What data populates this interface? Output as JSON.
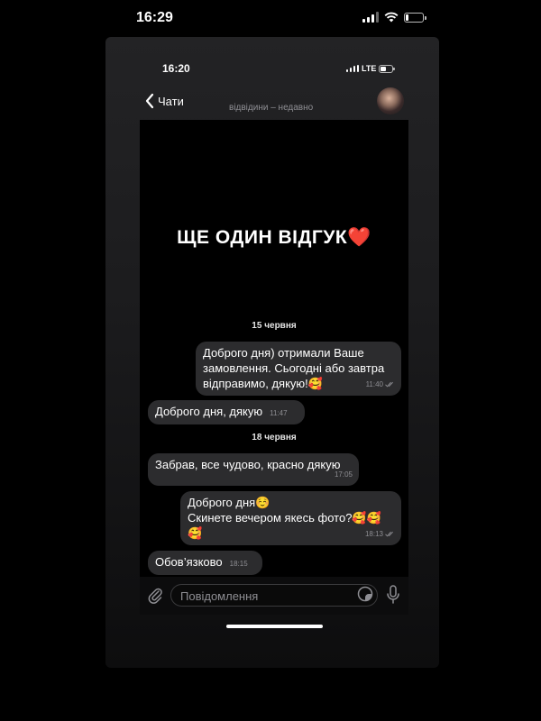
{
  "outer_status": {
    "time": "16:29",
    "battery_level": 0.2
  },
  "inner_status": {
    "time": "16:20",
    "network": "LTE",
    "battery_level": 0.5
  },
  "header": {
    "back_label": "Чати",
    "status": "відвідини – недавно"
  },
  "headline": {
    "text": "ЩЕ ОДИН ВІДГУК",
    "emoji": "❤️"
  },
  "messages": [
    {
      "type": "date",
      "text": "15 червня"
    },
    {
      "type": "outgoing",
      "text": "Доброго дня) отримали Ваше\nзамовлення. Сьогодні або завтра\nвідправимо, дякую!🥰",
      "time": "11:40"
    },
    {
      "type": "incoming",
      "text": "Доброго дня, дякую",
      "time": "11:47"
    },
    {
      "type": "date",
      "text": "18 червня"
    },
    {
      "type": "incoming",
      "text": "Забрав, все чудово, красно дякую",
      "time": "17:05"
    },
    {
      "type": "outgoing",
      "text": "Доброго дня☺️\nСкинете вечером якесь фото?🥰🥰\n🥰",
      "time": "18:13"
    },
    {
      "type": "incoming",
      "text": "Обов’язково",
      "time": "18:15"
    }
  ],
  "composer": {
    "placeholder": "Повідомлення"
  }
}
